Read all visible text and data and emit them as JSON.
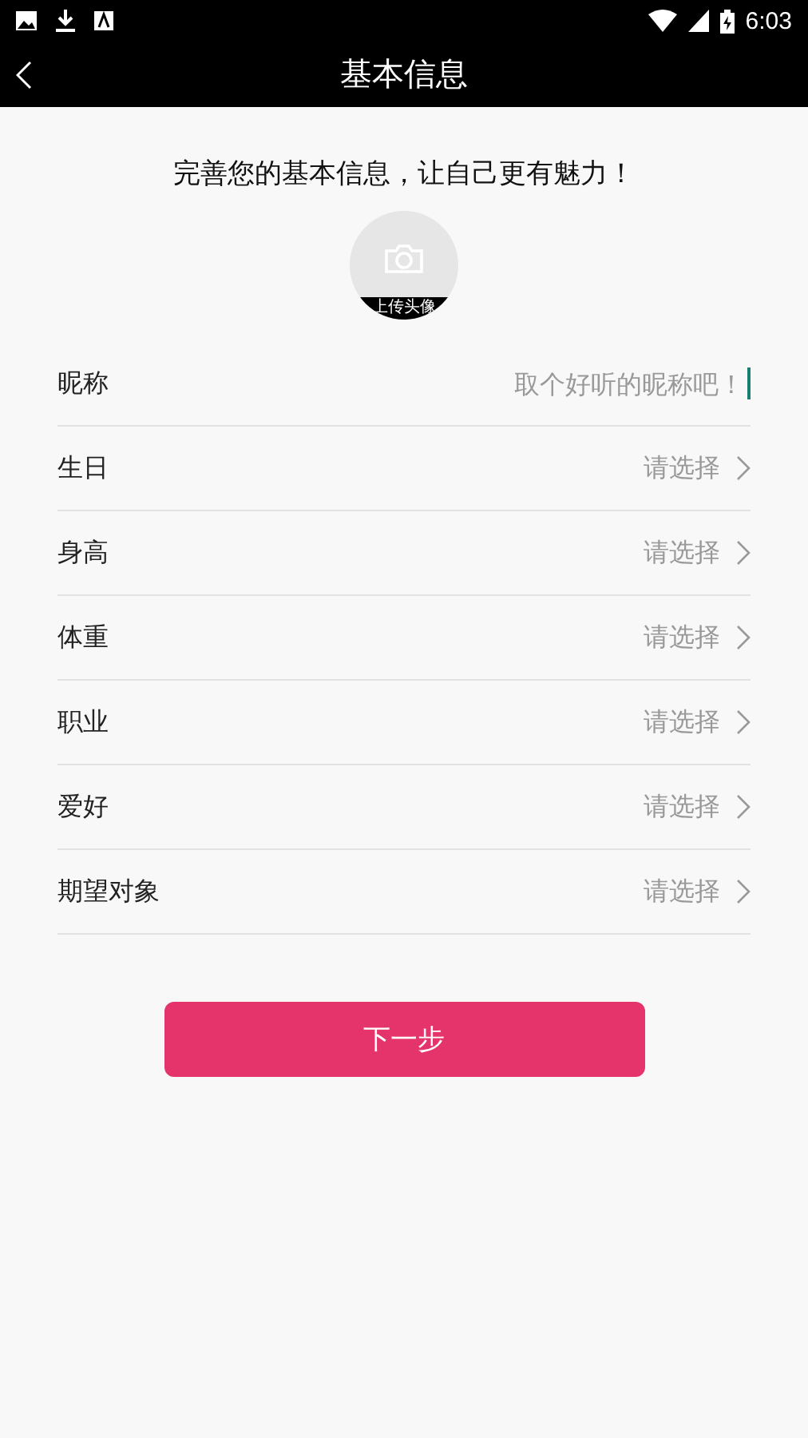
{
  "status_bar": {
    "time": "6:03"
  },
  "header": {
    "title": "基本信息"
  },
  "intro": "完善您的基本信息，让自己更有魅力！",
  "avatar": {
    "label": "上传头像"
  },
  "fields": [
    {
      "kind": "input",
      "label": "昵称",
      "placeholder": "取个好听的昵称吧！"
    },
    {
      "kind": "select",
      "label": "生日",
      "value": "请选择"
    },
    {
      "kind": "select",
      "label": "身高",
      "value": "请选择"
    },
    {
      "kind": "select",
      "label": "体重",
      "value": "请选择"
    },
    {
      "kind": "select",
      "label": "职业",
      "value": "请选择"
    },
    {
      "kind": "select",
      "label": "爱好",
      "value": "请选择"
    },
    {
      "kind": "select",
      "label": "期望对象",
      "value": "请选择"
    }
  ],
  "next_button": "下一步"
}
